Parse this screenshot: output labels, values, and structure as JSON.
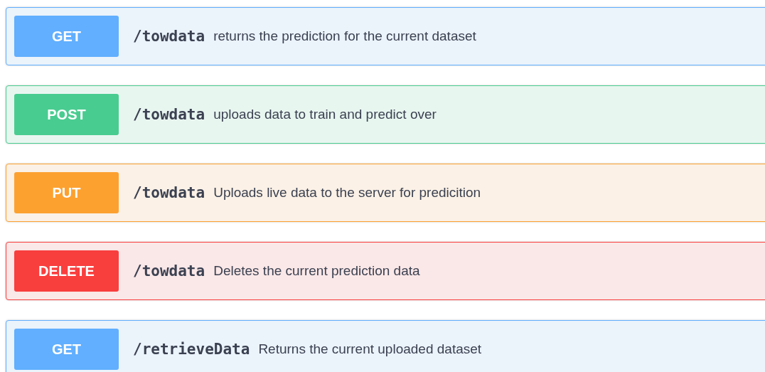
{
  "operations": [
    {
      "method": "GET",
      "path": "/towdata",
      "description": "returns the prediction for the current dataset"
    },
    {
      "method": "POST",
      "path": "/towdata",
      "description": "uploads data to train and predict over"
    },
    {
      "method": "PUT",
      "path": "/towdata",
      "description": "Uploads live data to the server for predicition"
    },
    {
      "method": "DELETE",
      "path": "/towdata",
      "description": "Deletes the current prediction data"
    },
    {
      "method": "GET",
      "path": "/retrieveData",
      "description": "Returns the current uploaded dataset"
    }
  ]
}
